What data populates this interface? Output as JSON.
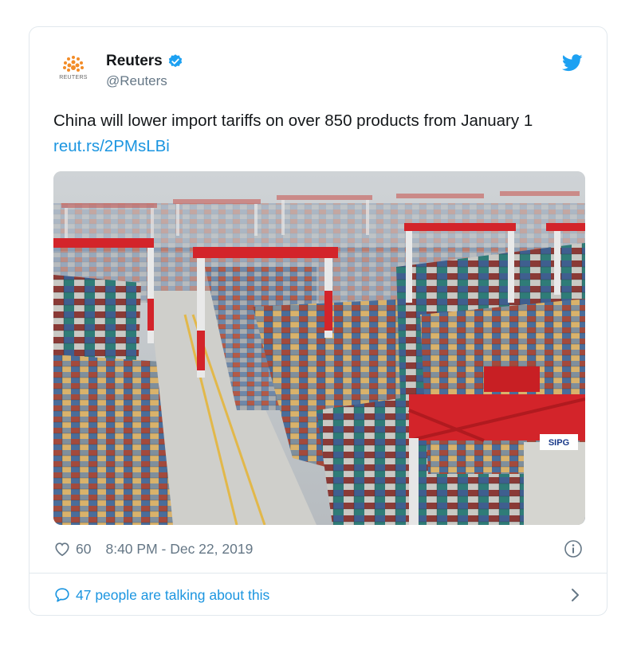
{
  "account": {
    "display_name": "Reuters",
    "handle": "@Reuters",
    "avatar_text": "REUTERS",
    "verified": true
  },
  "tweet": {
    "text": "China will lower import tariffs on over 850 products from January 1 ",
    "link": "reut.rs/2PMsLBi"
  },
  "media": {
    "crane_label": "SIPG"
  },
  "meta": {
    "likes": "60",
    "timestamp": "8:40 PM - Dec 22, 2019"
  },
  "footer": {
    "talking": "47 people are talking about this"
  },
  "colors": {
    "link_blue": "#1b95e0",
    "twitter_blue": "#1da1f2",
    "muted_gray": "#657786",
    "crane_red": "#d3242a"
  },
  "icons": [
    "reuters-logo-icon",
    "verified-badge-icon",
    "twitter-bird-icon",
    "heart-icon",
    "info-icon",
    "speech-bubble-icon",
    "chevron-right-icon"
  ]
}
